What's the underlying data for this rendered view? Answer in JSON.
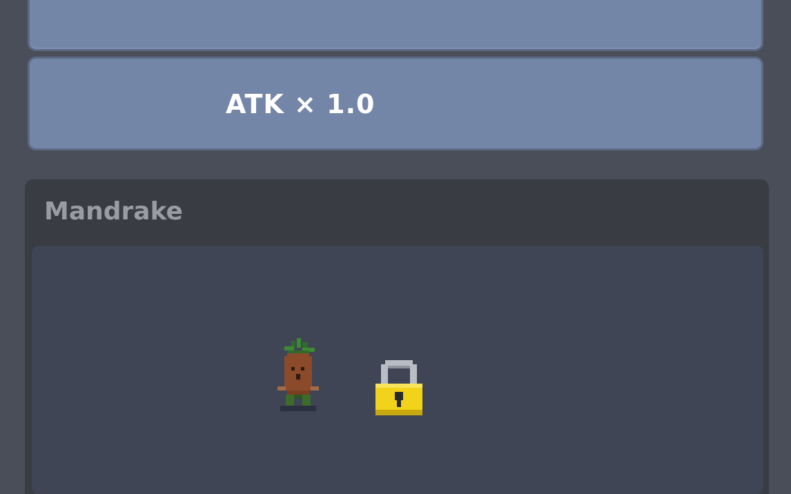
{
  "stats": {
    "atk_label": "ATK × 1.0"
  },
  "character": {
    "name": "Mandrake",
    "sprite_icon": "mandrake-icon",
    "locked": true,
    "lock_icon": "padlock-icon"
  },
  "colors": {
    "card_blue": "#7486a8",
    "panel_dark": "#393c43",
    "panel_inner": "#3f4555",
    "lock_gold": "#f2d31b"
  }
}
